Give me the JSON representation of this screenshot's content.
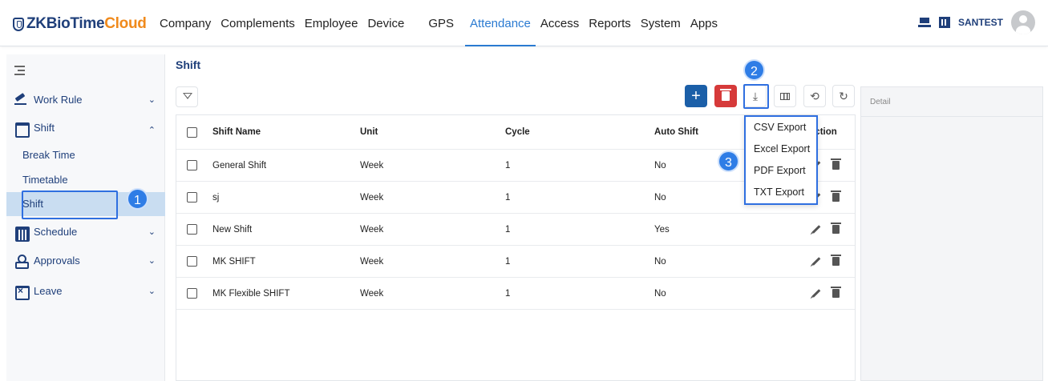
{
  "app": {
    "logo_part1": "ZKBioTime",
    "logo_part2": "Cloud"
  },
  "nav": [
    "Company",
    "Complements",
    "Employee",
    "Device",
    "GPS",
    "Attendance",
    "Access",
    "Reports",
    "System",
    "Apps"
  ],
  "nav_active": "Attendance",
  "user": {
    "name": "SANTEST"
  },
  "sidebar": {
    "items": [
      {
        "label": "Work Rule",
        "icon": "gavel-icon",
        "chevron": "⌄"
      },
      {
        "label": "Shift",
        "icon": "calendar-icon",
        "chevron": "⌃"
      },
      {
        "label": "Schedule",
        "icon": "calendar-grid-icon",
        "chevron": "⌄"
      },
      {
        "label": "Approvals",
        "icon": "person-icon",
        "chevron": "⌄"
      },
      {
        "label": "Leave",
        "icon": "calendar-x-icon",
        "chevron": "⌄"
      }
    ],
    "sub_items": [
      "Break Time",
      "Timetable",
      "Shift"
    ],
    "active_sub": "Shift"
  },
  "page": {
    "title": "Shift"
  },
  "toolbar": {
    "add_label": "+"
  },
  "table": {
    "headers": [
      "Shift Name",
      "Unit",
      "Cycle",
      "Auto Shift",
      "Action"
    ],
    "rows": [
      {
        "name": "General Shift",
        "unit": "Week",
        "cycle": "1",
        "auto": "No"
      },
      {
        "name": "sj",
        "unit": "Week",
        "cycle": "1",
        "auto": "No"
      },
      {
        "name": "New Shift",
        "unit": "Week",
        "cycle": "1",
        "auto": "Yes"
      },
      {
        "name": "MK SHIFT",
        "unit": "Week",
        "cycle": "1",
        "auto": "No"
      },
      {
        "name": "MK Flexible SHIFT",
        "unit": "Week",
        "cycle": "1",
        "auto": "No"
      }
    ]
  },
  "export_menu": [
    "CSV Export",
    "Excel Export",
    "PDF Export",
    "TXT Export"
  ],
  "detail": {
    "title": "Detail"
  },
  "callouts": [
    "1",
    "2",
    "3"
  ],
  "colors": {
    "brand_navy": "#1f3f7a",
    "brand_orange": "#f08a1c",
    "accent_blue": "#2a7ad1",
    "delete_red": "#d63a3a",
    "callout_blue": "#2f7de6"
  }
}
